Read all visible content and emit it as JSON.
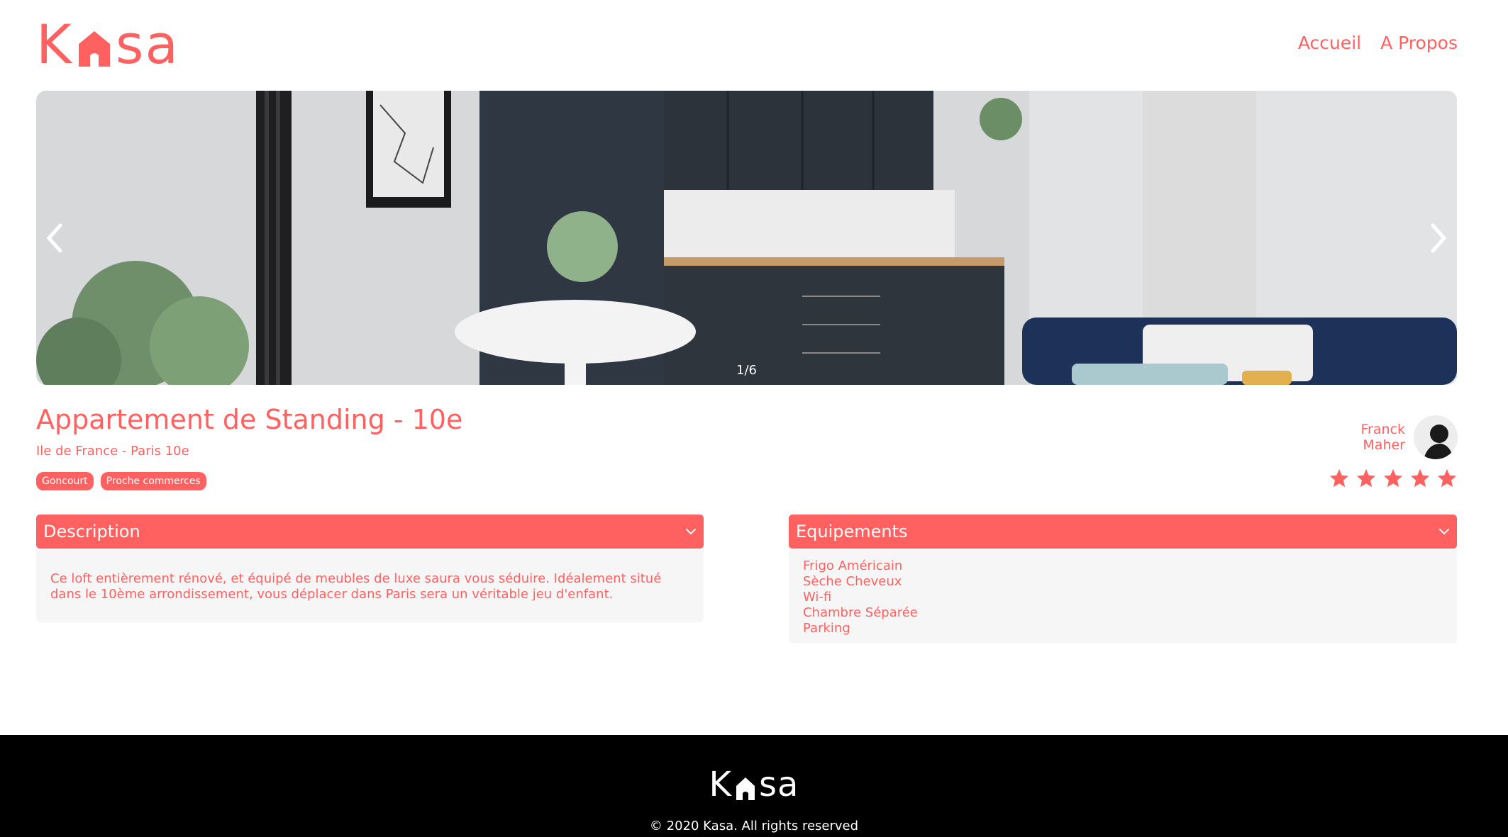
{
  "header": {
    "logo_left": "K",
    "logo_right": "sa",
    "nav": {
      "home": "Accueil",
      "about": "A Propos"
    }
  },
  "carousel": {
    "counter": "1/6"
  },
  "listing": {
    "title": "Appartement de Standing - 10e",
    "location": "Ile de France - Paris 10e",
    "tags": [
      "Goncourt",
      "Proche commerces"
    ],
    "host_first": "Franck",
    "host_last": "Maher",
    "rating": 5,
    "rating_max": 5
  },
  "description": {
    "title": "Description",
    "text": "Ce loft entièrement rénové, et équipé de meubles de luxe saura vous séduire. Idéalement situé dans le 10ème arrondissement, vous déplacer dans Paris sera un véritable jeu d'enfant."
  },
  "equipments": {
    "title": "Equipements",
    "items": [
      "Frigo Américain",
      "Sèche Cheveux",
      "Wi-fi",
      "Chambre Séparée",
      "Parking"
    ]
  },
  "footer": {
    "logo_left": "K",
    "logo_right": "sa",
    "copyright": "© 2020 Kasa. All rights reserved"
  },
  "colors": {
    "accent": "#FF6060",
    "panel": "#F6F6F6",
    "footer_bg": "#000000"
  }
}
